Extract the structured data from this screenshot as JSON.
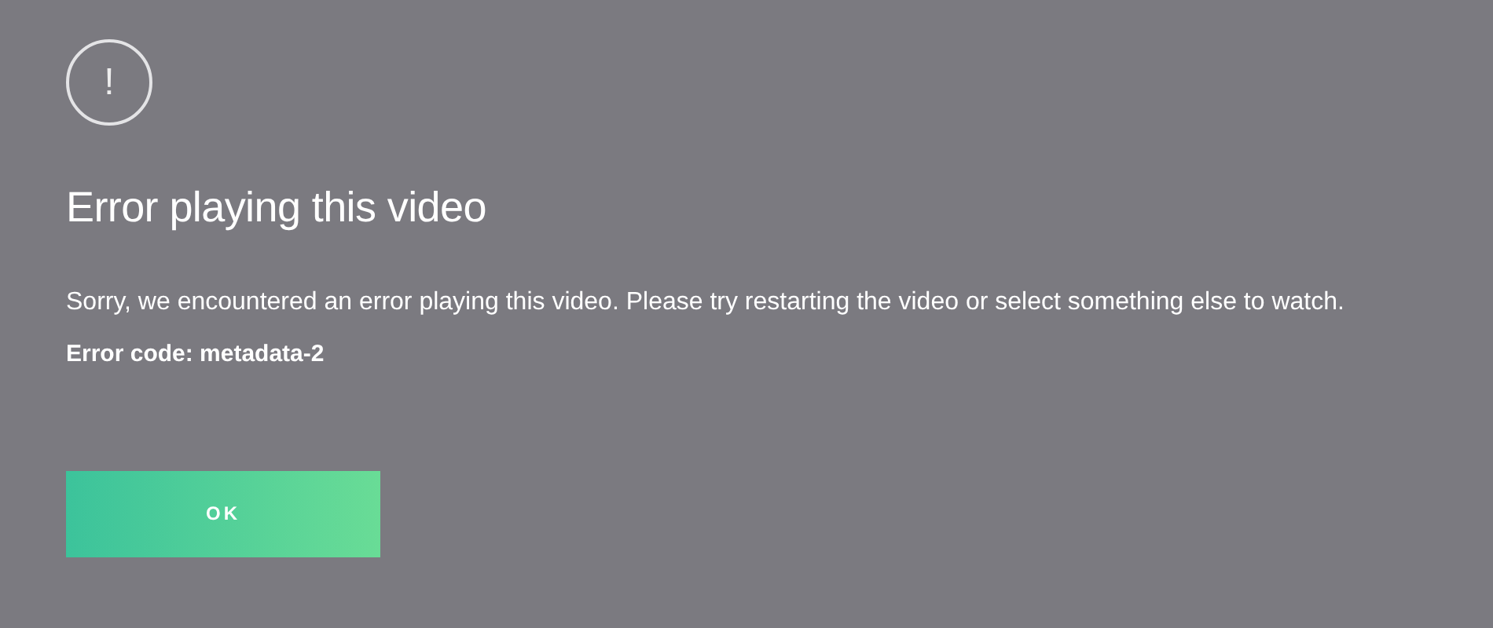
{
  "dialog": {
    "icon_glyph": "!",
    "title": "Error playing this video",
    "message": "Sorry, we encountered an error playing this video. Please try restarting the video or select something else to watch.",
    "error_code": "Error code: metadata-2",
    "buttons": [
      "OK"
    ]
  }
}
